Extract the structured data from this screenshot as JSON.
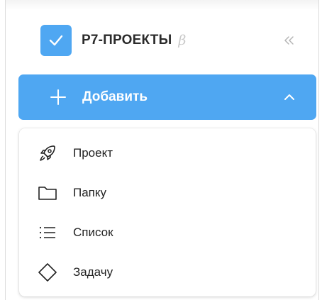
{
  "app": {
    "title": "Р7-ПРОЕКТЫ",
    "beta_mark": "β",
    "logo_icon": "checkmark-icon",
    "collapse_icon": "double-chevron-left-icon"
  },
  "add_button": {
    "label": "Добавить",
    "icon": "plus-icon",
    "state_icon": "chevron-up-icon",
    "expanded": true
  },
  "menu": {
    "items": [
      {
        "label": "Проект",
        "icon": "rocket-icon"
      },
      {
        "label": "Папку",
        "icon": "folder-icon"
      },
      {
        "label": "Список",
        "icon": "list-icon"
      },
      {
        "label": "Задачу",
        "icon": "diamond-icon"
      }
    ]
  },
  "colors": {
    "accent": "#4fa7f2",
    "text": "#222222",
    "muted": "#c9c9c9"
  }
}
